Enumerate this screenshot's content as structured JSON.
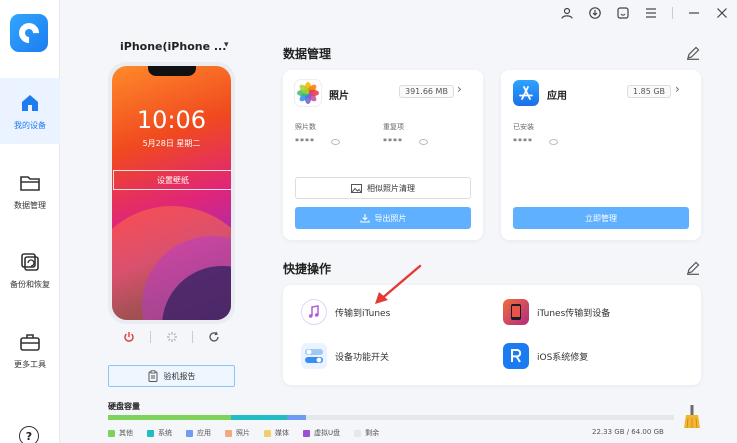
{
  "sidebar": {
    "items": [
      {
        "label": "我的设备",
        "icon": "home-icon",
        "active": true
      },
      {
        "label": "数据管理",
        "icon": "folder-icon"
      },
      {
        "label": "备份和恢复",
        "icon": "backup-icon"
      },
      {
        "label": "更多工具",
        "icon": "toolbox-icon"
      }
    ],
    "help": "?"
  },
  "titlebar": {
    "icons": [
      "user-icon",
      "download-icon",
      "feedback-icon",
      "menu-icon",
      "minimize-icon",
      "close-icon"
    ]
  },
  "device": {
    "name": "iPhone(iPhone ...",
    "time": "10:06",
    "date": "5月28日 星期二",
    "wallpaper_button": "设置壁纸",
    "report_button": "验机报告"
  },
  "data_management": {
    "title": "数据管理",
    "photos": {
      "name": "照片",
      "size": "391.66 MB",
      "stat1_label": "照片数",
      "stat1_value": "****",
      "stat2_label": "重复项",
      "stat2_value": "****",
      "secondary_button": "相似照片清理",
      "primary_button": "导出照片"
    },
    "apps": {
      "name": "应用",
      "size": "1.85 GB",
      "stat1_label": "已安装",
      "stat1_value": "****",
      "primary_button": "立即管理"
    }
  },
  "quick_actions": {
    "title": "快捷操作",
    "items": [
      {
        "label": "传输到iTunes",
        "icon": "itunes-icon"
      },
      {
        "label": "iTunes传输到设备",
        "icon": "itunes-to-device-icon"
      },
      {
        "label": "设备功能开关",
        "icon": "toggle-icon"
      },
      {
        "label": "iOS系统修复",
        "icon": "ios-repair-icon"
      }
    ]
  },
  "disk": {
    "title": "硬盘容量",
    "used": "22.33 GB / 64.00 GB",
    "legend": [
      {
        "label": "其他",
        "color": "#7ed35b"
      },
      {
        "label": "系统",
        "color": "#22bcc4"
      },
      {
        "label": "应用",
        "color": "#6d9cf2"
      },
      {
        "label": "照片",
        "color": "#f3a882"
      },
      {
        "label": "媒体",
        "color": "#f2cf6e"
      },
      {
        "label": "虚拟U盘",
        "color": "#9c4fd6"
      },
      {
        "label": "剩余",
        "color": "#e4e7eb"
      }
    ],
    "segments": [
      {
        "label": "其他",
        "fraction": 0.217,
        "color": "#7ed35b"
      },
      {
        "label": "系统",
        "fraction": 0.1,
        "color": "#22bcc4"
      },
      {
        "label": "应用",
        "fraction": 0.032,
        "color": "#6d9cf2"
      }
    ]
  }
}
